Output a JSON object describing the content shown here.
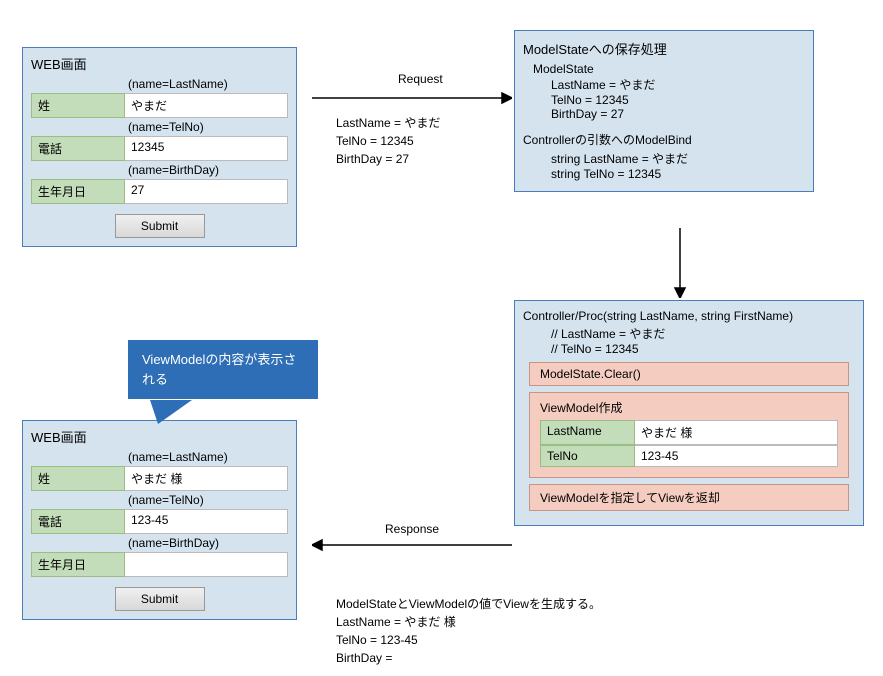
{
  "form1": {
    "title": "WEB画面",
    "field_lastname_note": "(name=LastName)",
    "field_lastname_label": "姓",
    "field_lastname_value": "やまだ",
    "field_telno_note": "(name=TelNo)",
    "field_telno_label": "電話",
    "field_telno_value": "12345",
    "field_birthday_note": "(name=BirthDay)",
    "field_birthday_label": "生年月日",
    "field_birthday_value": "27",
    "submit": "Submit"
  },
  "request": {
    "label": "Request",
    "l1": "LastName = やまだ",
    "l2": "TelNo = 12345",
    "l3": "BirthDay = 27"
  },
  "modelstate": {
    "title": "ModelStateへの保存処理",
    "sub": "ModelState",
    "l1": "LastName = やまだ",
    "l2": "TelNo = 12345",
    "l3": "BirthDay = 27",
    "bind_title": "Controllerの引数へのModelBind",
    "bind_l1": "string LastName = やまだ",
    "bind_l2": "string TelNo = 12345"
  },
  "controller": {
    "sig": "Controller/Proc(string LastName, string FirstName)",
    "c1": "// LastName = やまだ",
    "c2": "// TelNo = 12345",
    "clear": "ModelState.Clear()",
    "vm_title": "ViewModel作成",
    "vm_lastname_key": "LastName",
    "vm_lastname_val": "やまだ 様",
    "vm_telno_key": "TelNo",
    "vm_telno_val": "123-45",
    "return_view": "ViewModelを指定してViewを返却"
  },
  "response": {
    "label": "Response",
    "gen": "ModelStateとViewModelの値でViewを生成する。",
    "l1": "LastName = やまだ 様",
    "l2": "TelNo = 123-45",
    "l3": "BirthDay ="
  },
  "form2": {
    "title": "WEB画面",
    "field_lastname_note": "(name=LastName)",
    "field_lastname_label": "姓",
    "field_lastname_value": "やまだ 様",
    "field_telno_note": "(name=TelNo)",
    "field_telno_label": "電話",
    "field_telno_value": "123-45",
    "field_birthday_note": "(name=BirthDay)",
    "field_birthday_label": "生年月日",
    "field_birthday_value": "",
    "submit": "Submit"
  },
  "callout": {
    "text": "ViewModelの内容が表示される"
  }
}
